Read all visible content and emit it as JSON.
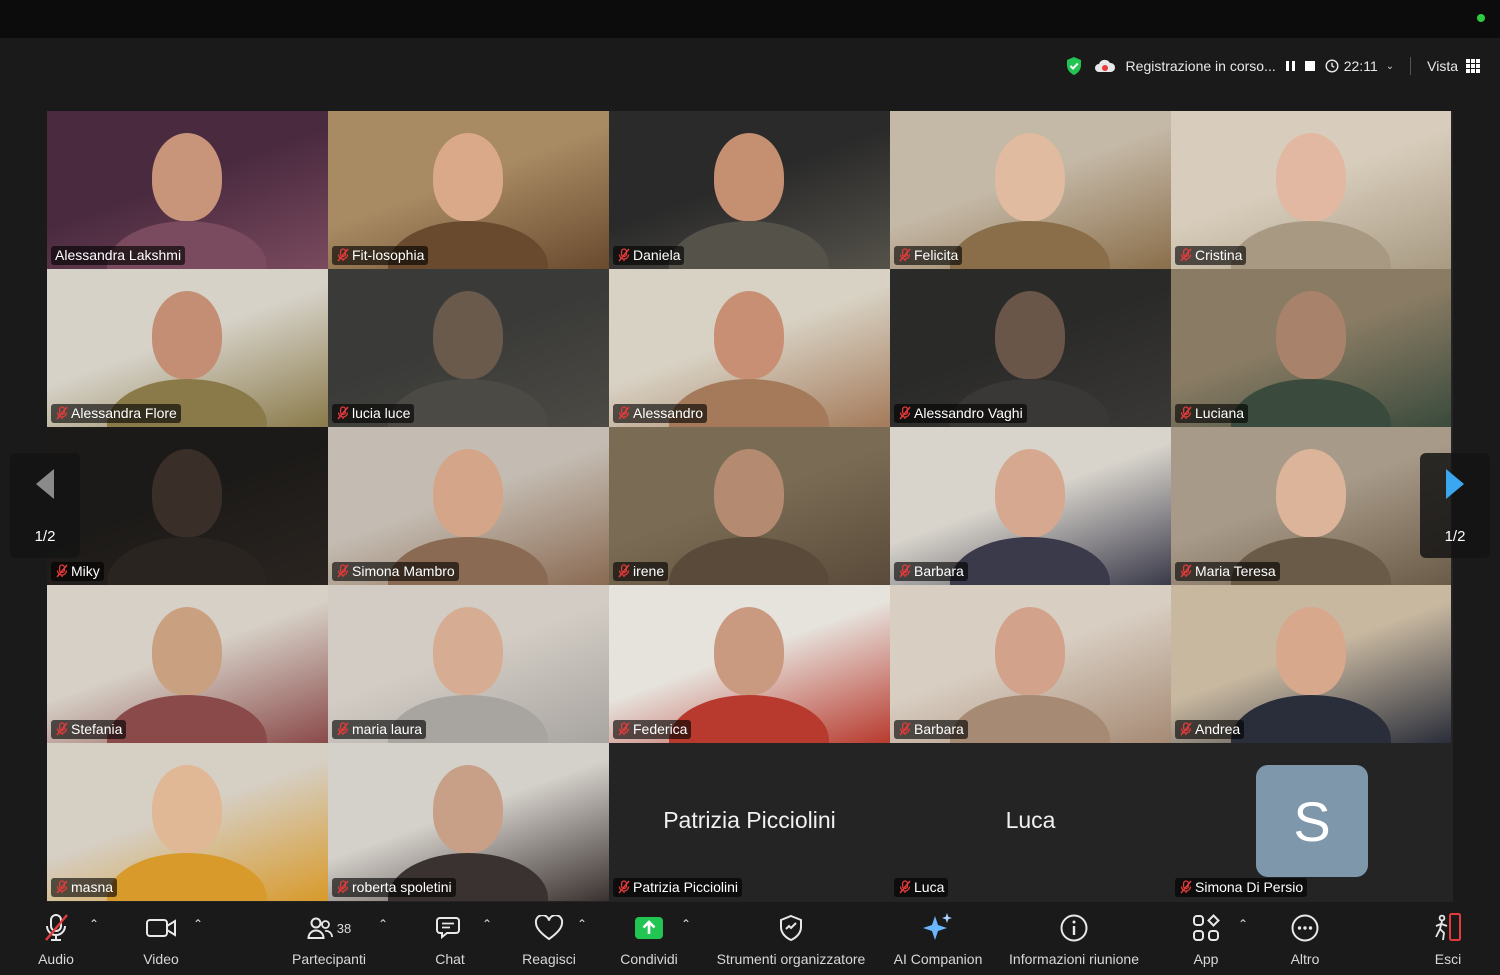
{
  "topbar": {
    "recording_label": "Registrazione in corso...",
    "timer": "22:11",
    "view_label": "Vista"
  },
  "colors": {
    "active_speaker_border": "#33cc55",
    "muted_icon": "#e33b3b",
    "share_green": "#23c552",
    "avatar_bg": "#7e97aa"
  },
  "pagination": {
    "left": "1/2",
    "right": "1/2"
  },
  "participants": [
    {
      "name": "Alessandra Lakshmi",
      "muted": false,
      "active": true
    },
    {
      "name": "Fit-losophia",
      "muted": true
    },
    {
      "name": "Daniela",
      "muted": true
    },
    {
      "name": "Felicita",
      "muted": true
    },
    {
      "name": "Cristina",
      "muted": true
    },
    {
      "name": "Alessandra Flore",
      "muted": true
    },
    {
      "name": "lucia luce",
      "muted": true
    },
    {
      "name": "Alessandro",
      "muted": true
    },
    {
      "name": "Alessandro Vaghi",
      "muted": true
    },
    {
      "name": "Luciana",
      "muted": true
    },
    {
      "name": "Miky",
      "muted": true
    },
    {
      "name": "Simona Mambro",
      "muted": true
    },
    {
      "name": "irene",
      "muted": true
    },
    {
      "name": "Barbara",
      "muted": true
    },
    {
      "name": "Maria Teresa",
      "muted": true
    },
    {
      "name": "Stefania",
      "muted": true
    },
    {
      "name": "maria laura",
      "muted": true
    },
    {
      "name": "Federica",
      "muted": true
    },
    {
      "name": "Barbara",
      "muted": true
    },
    {
      "name": "Andrea",
      "muted": true
    },
    {
      "name": "masna",
      "muted": true
    },
    {
      "name": "roberta spoletini",
      "muted": true
    },
    {
      "name": "Patrizia Picciolini",
      "muted": true,
      "video_off": true,
      "display_name": "Patrizia Picciolini"
    },
    {
      "name": "Luca",
      "muted": true,
      "video_off": true,
      "display_name": "Luca"
    },
    {
      "name": "Simona Di Persio",
      "muted": true,
      "video_off": true,
      "avatar_letter": "S"
    }
  ],
  "toolbar": {
    "audio": "Audio",
    "video": "Video",
    "participants": "Partecipanti",
    "participants_count": "38",
    "chat": "Chat",
    "react": "Reagisci",
    "share": "Condividi",
    "host_tools": "Strumenti organizzatore",
    "ai_companion": "AI Companion",
    "meeting_info": "Informazioni riunione",
    "apps": "App",
    "more": "Altro",
    "leave": "Esci"
  }
}
